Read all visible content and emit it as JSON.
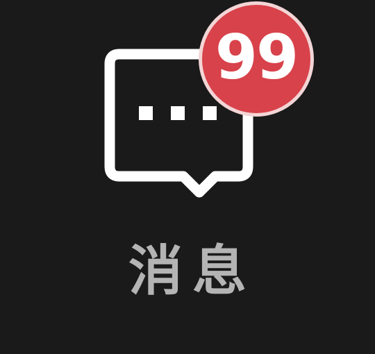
{
  "tab": {
    "label": "消息",
    "icon": "message-bubble-icon",
    "badge": {
      "count": "99",
      "color": "#d8424a",
      "border_color": "#f3d5d6"
    }
  },
  "colors": {
    "background": "#1a1a1a",
    "icon": "#ffffff",
    "label": "#b4b4b4"
  }
}
